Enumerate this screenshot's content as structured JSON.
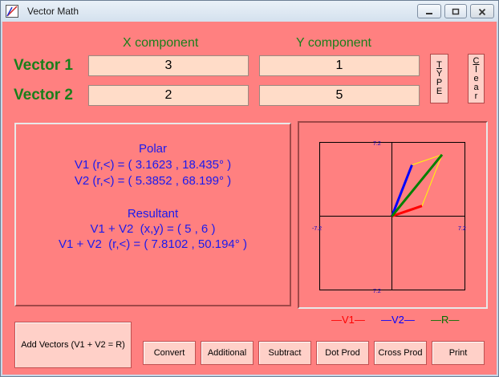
{
  "window": {
    "title": "Vector Math"
  },
  "headers": {
    "x": "X component",
    "y": "Y component"
  },
  "vectors": [
    {
      "label": "Vector 1",
      "x": "3",
      "y": "1"
    },
    {
      "label": "Vector 2",
      "x": "2",
      "y": "5"
    }
  ],
  "side_buttons": {
    "type": [
      "T",
      "Y",
      "P",
      "E"
    ],
    "clear": [
      "C",
      "l",
      "e",
      "a",
      "r"
    ]
  },
  "results": {
    "polar_title": "Polar",
    "v1_polar": "V1 (r,<) = ( 3.1623 , 18.435° )",
    "v2_polar": "V2 (r,<) = ( 5.3852 , 68.199° )",
    "resultant_title": "Resultant",
    "sum_xy": "V1 + V2  (x,y) = ( 5 , 6 )",
    "sum_polar": "V1 + V2  (r,<) = ( 7.8102 , 50.194° )"
  },
  "graph": {
    "tick_top": "7.2",
    "tick_bottom": "7.2",
    "tick_left": "-7.2",
    "tick_right": "7.2",
    "axis_limit": 7.2,
    "v1": [
      3,
      1
    ],
    "v2": [
      2,
      5
    ],
    "r": [
      5,
      6
    ],
    "colors": {
      "v1": "#ff0000",
      "v2": "#0000ff",
      "r": "#008000",
      "guide": "#ffff00"
    }
  },
  "legend": {
    "v1": "—V1—",
    "v2": "—V2—",
    "r": "—R—"
  },
  "buttons": {
    "add": "Add Vectors (V1 + V2 = R)",
    "convert": "Convert",
    "additional": "Additional",
    "subtract": "Subtract",
    "dot": "Dot Prod",
    "cross": "Cross Prod",
    "print": "Print"
  }
}
